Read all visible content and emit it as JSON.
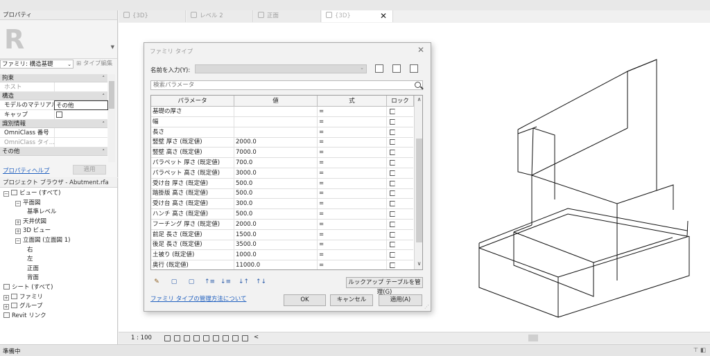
{
  "properties_panel": {
    "title": "プロパティ",
    "family_select": "ファミリ: 構造基礎",
    "type_edit": "タイプ編集",
    "groups": [
      {
        "name": "拘束",
        "rows": [
          {
            "key": "ホスト",
            "value": "",
            "grey": true
          }
        ]
      },
      {
        "name": "構造",
        "rows": [
          {
            "key": "モデルのマテリアル...",
            "value": "その他",
            "active": true
          },
          {
            "key": "キャップ",
            "value": "",
            "checkbox": true
          }
        ]
      },
      {
        "name": "識別情報",
        "rows": [
          {
            "key": "OmniClass 番号",
            "value": ""
          },
          {
            "key": "OmniClass タイ...",
            "value": "",
            "grey": true
          }
        ]
      },
      {
        "name": "その他",
        "rows": []
      }
    ],
    "help_link": "プロパティヘルプ",
    "apply_button": "適用"
  },
  "project_browser": {
    "title": "プロジェクト ブラウザ - Abutment.rfa",
    "nodes": [
      {
        "label": "ビュー (すべて)",
        "level": 0,
        "exp": "−"
      },
      {
        "label": "平面図",
        "level": 1,
        "exp": "−"
      },
      {
        "label": "基準レベル",
        "level": 2,
        "exp": ""
      },
      {
        "label": "天井伏図",
        "level": 1,
        "exp": "+"
      },
      {
        "label": "3D ビュー",
        "level": 1,
        "exp": "+"
      },
      {
        "label": "立面図 (立面図 1)",
        "level": 1,
        "exp": "−"
      },
      {
        "label": "右",
        "level": 2,
        "exp": ""
      },
      {
        "label": "左",
        "level": 2,
        "exp": ""
      },
      {
        "label": "正面",
        "level": 2,
        "exp": ""
      },
      {
        "label": "背面",
        "level": 2,
        "exp": ""
      },
      {
        "label": "シート (すべて)",
        "level": 0,
        "exp": ""
      },
      {
        "label": "ファミリ",
        "level": 0,
        "exp": "+"
      },
      {
        "label": "グループ",
        "level": 0,
        "exp": "+"
      },
      {
        "label": "Revit リンク",
        "level": 0,
        "exp": ""
      }
    ]
  },
  "tabs": [
    {
      "label": "{3D}",
      "active": false
    },
    {
      "label": "レベル 2",
      "active": false
    },
    {
      "label": "正面",
      "active": false
    },
    {
      "label": "{3D}",
      "active": true
    }
  ],
  "tab_close": "✕",
  "viewbar": {
    "scale": "1 : 100"
  },
  "status": {
    "text": "準備中"
  },
  "dialog": {
    "title": "ファミリ タイプ",
    "name_label": "名前を入力(Y):",
    "search_placeholder": "検索パラメータ",
    "columns": [
      "パラメータ",
      "値",
      "式",
      "ロック"
    ],
    "rows": [
      {
        "param": "基礎の厚さ",
        "value": "",
        "formula": "="
      },
      {
        "param": "幅",
        "value": "",
        "formula": "="
      },
      {
        "param": "長さ",
        "value": "",
        "formula": "="
      },
      {
        "param": "竪壁 厚さ (既定値)",
        "value": "2000.0",
        "formula": "="
      },
      {
        "param": "竪壁 高さ (既定値)",
        "value": "7000.0",
        "formula": "="
      },
      {
        "param": "パラペット 厚さ (既定値)",
        "value": "700.0",
        "formula": "="
      },
      {
        "param": "パラペット 高さ (既定値)",
        "value": "3000.0",
        "formula": "="
      },
      {
        "param": "受け台 厚さ (既定値)",
        "value": "500.0",
        "formula": "="
      },
      {
        "param": "踏掛版 高さ (既定値)",
        "value": "500.0",
        "formula": "="
      },
      {
        "param": "受け台 高さ (既定値)",
        "value": "300.0",
        "formula": "="
      },
      {
        "param": "ハンチ 高さ (既定値)",
        "value": "500.0",
        "formula": "="
      },
      {
        "param": "フーチング 厚さ (既定値)",
        "value": "2000.0",
        "formula": "="
      },
      {
        "param": "前足 長さ (既定値)",
        "value": "1500.0",
        "formula": "="
      },
      {
        "param": "後足 長さ (既定値)",
        "value": "3500.0",
        "formula": "="
      },
      {
        "param": "土被り (既定値)",
        "value": "1000.0",
        "formula": "="
      },
      {
        "param": "奥行 (既定値)",
        "value": "11000.0",
        "formula": "="
      }
    ],
    "lookup_button": "ルックアップ テーブルを管理(G)",
    "manage_link": "ファミリ タイプの管理方法について",
    "ok_button": "OK",
    "cancel_button": "キャンセル",
    "apply_button": "適用(A)"
  }
}
